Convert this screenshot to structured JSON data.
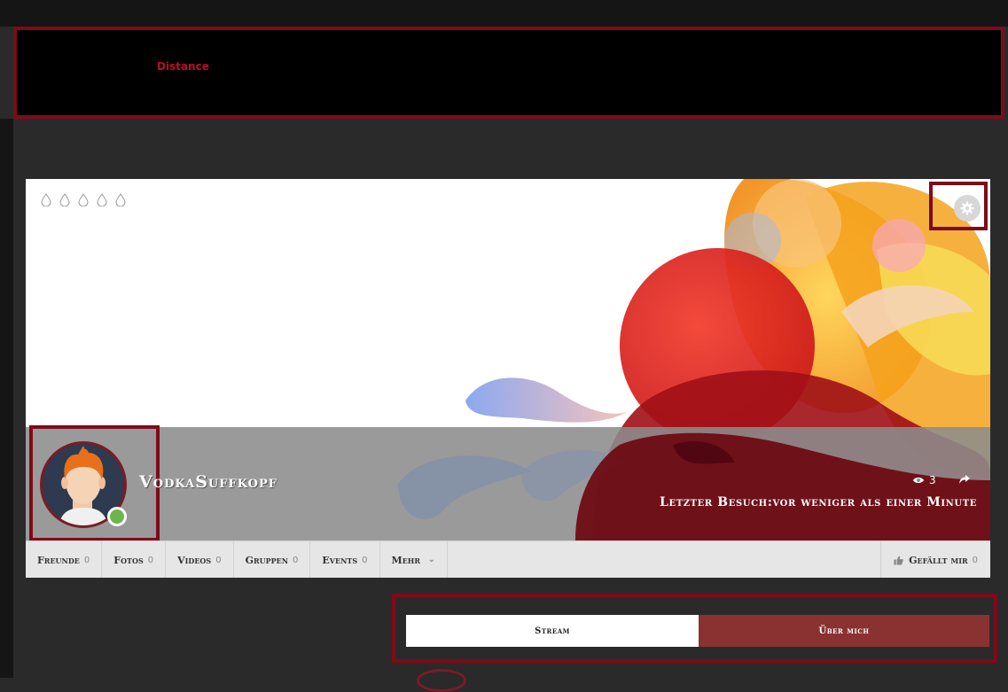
{
  "banner": {
    "label": "Distance"
  },
  "profile": {
    "username": "VodkaSuffkopf",
    "views": "3",
    "last_visit": "Letzter Besuch:vor weniger als einer Minute",
    "online": true
  },
  "icons": {
    "settings": "gear-icon",
    "share": "share-icon",
    "views": "eye-icon",
    "like": "thumbs-up-icon",
    "drops": "raindrop-icon"
  },
  "nav": {
    "items": [
      {
        "label": "Freunde",
        "count": "0"
      },
      {
        "label": "Fotos",
        "count": "0"
      },
      {
        "label": "Videos",
        "count": "0"
      },
      {
        "label": "Gruppen",
        "count": "0"
      },
      {
        "label": "Events",
        "count": "0"
      }
    ],
    "more_label": "Mehr",
    "like": {
      "label": "Gefällt mir",
      "count": "0"
    }
  },
  "tabs": {
    "stream": "Stream",
    "about": "Über mich"
  },
  "colors": {
    "highlight": "#7e0b1a",
    "accent": "#8a3232",
    "online": "#6ab64a"
  }
}
